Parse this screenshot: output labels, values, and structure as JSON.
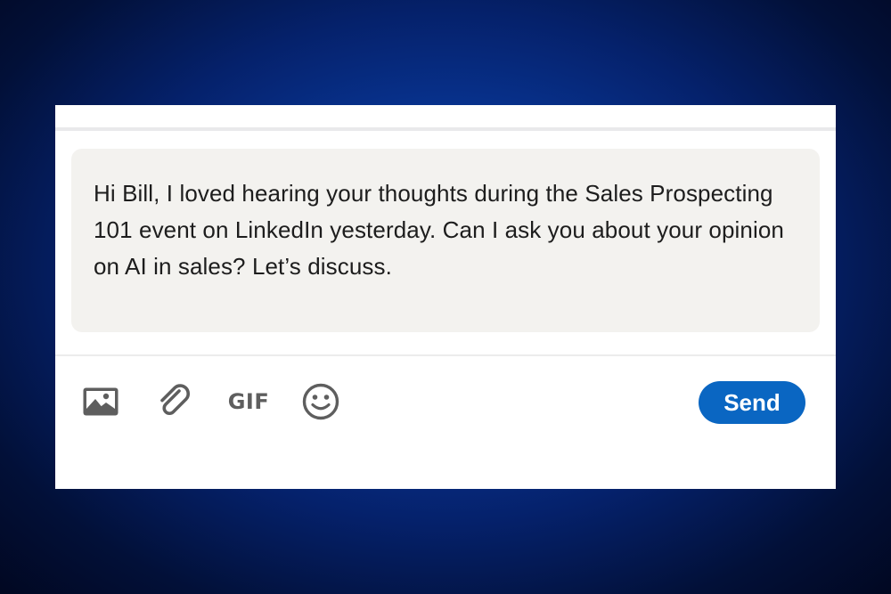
{
  "composer": {
    "message": "Hi Bill, I loved hearing your thoughts during the Sales Prospecting 101 event on LinkedIn yesterday. Can I ask you about your opinion on AI in sales? Let’s discuss."
  },
  "toolbar": {
    "icons": [
      "image-icon",
      "paperclip-icon",
      "gif-icon",
      "emoji-icon"
    ],
    "gif_label": "GIF",
    "send_label": "Send"
  },
  "colors": {
    "send_button": "#0a66c2",
    "message_background": "#f3f2ef",
    "icon_gray": "#5e5e5e"
  }
}
